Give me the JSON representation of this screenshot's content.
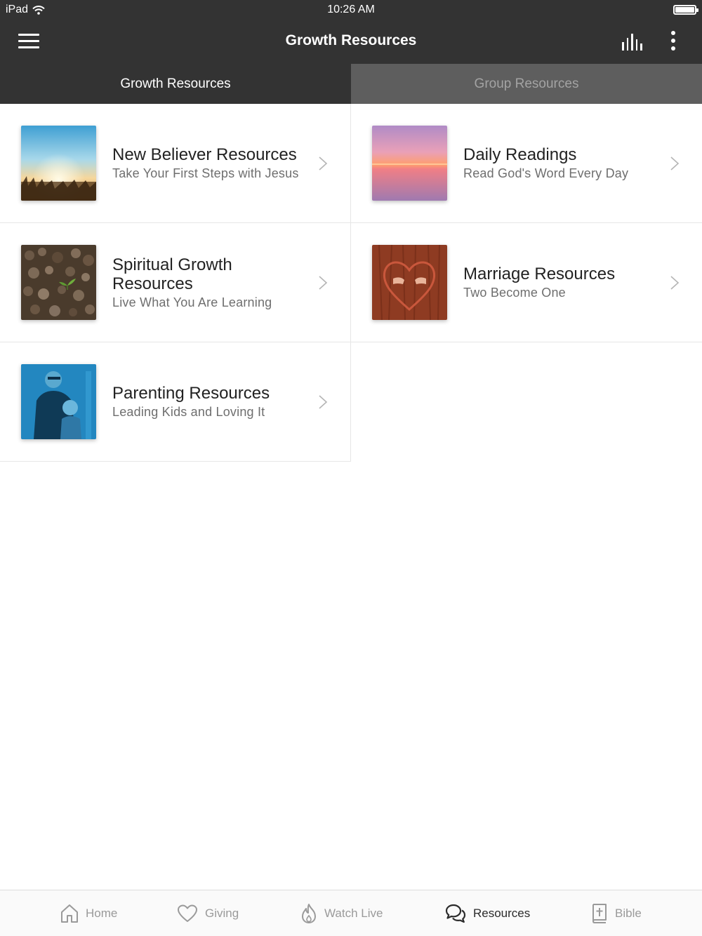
{
  "status_bar": {
    "device": "iPad",
    "time": "10:26 AM"
  },
  "nav": {
    "title": "Growth Resources"
  },
  "tabs": [
    {
      "label": "Growth Resources",
      "active": true
    },
    {
      "label": "Group Resources",
      "active": false
    }
  ],
  "resources": [
    {
      "title": "New Believer Resources",
      "subtitle": "Take Your First Steps with Jesus",
      "image": "sunrise-field-photo"
    },
    {
      "title": "Daily Readings",
      "subtitle": "Read God's Word Every Day",
      "image": "sunset-sea-photo"
    },
    {
      "title": "Spiritual Growth Resources",
      "subtitle": "Live What You Are Learning",
      "image": "seedling-soil-photo"
    },
    {
      "title": "Marriage Resources",
      "subtitle": "Two Become One",
      "image": "heart-on-tree-photo"
    },
    {
      "title": "Parenting Resources",
      "subtitle": "Leading Kids and Loving It",
      "image": "father-and-child-photo"
    }
  ],
  "tab_bar": [
    {
      "label": "Home",
      "icon": "home-icon",
      "active": false
    },
    {
      "label": "Giving",
      "icon": "heart-icon",
      "active": false
    },
    {
      "label": "Watch Live",
      "icon": "flame-icon",
      "active": false
    },
    {
      "label": "Resources",
      "icon": "chat-bubbles-icon",
      "active": true
    },
    {
      "label": "Bible",
      "icon": "bible-icon",
      "active": false
    }
  ],
  "colors": {
    "bar_dark": "#333333",
    "tab_inactive": "#5e5e5e",
    "text_muted": "#9a9a9a"
  }
}
